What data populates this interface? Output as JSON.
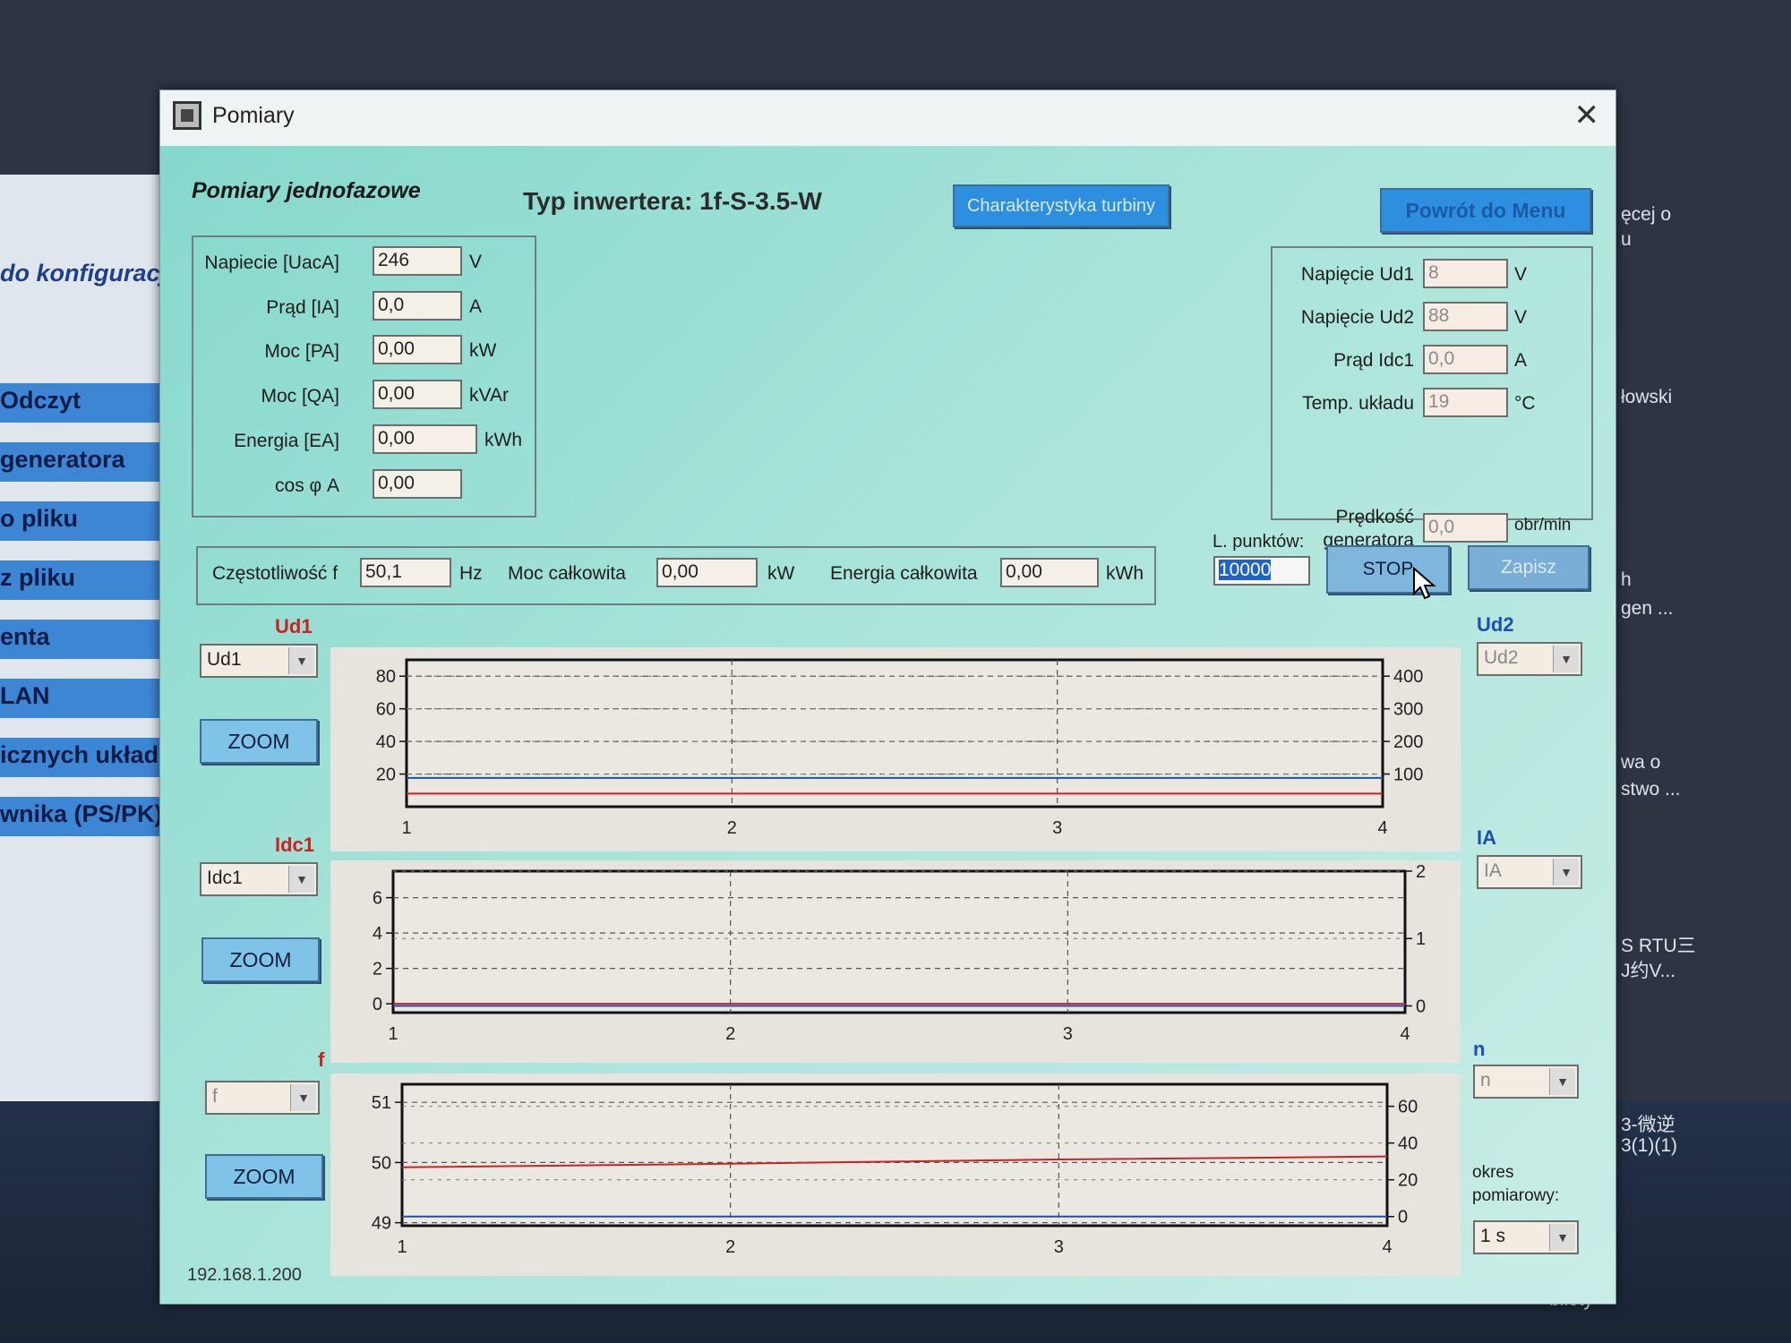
{
  "background_app": {
    "title": "do konfiguracji",
    "menu_items": [
      "Odczyt",
      "generatora",
      "o pliku",
      "z pliku",
      "enta",
      "LAN",
      "icznych układu",
      "wnika (PS/PK)"
    ],
    "right_texts": [
      "ęcej o",
      "u",
      "łowski",
      "h",
      "gen ...",
      "wa o",
      "stwo ...",
      "S RTU三",
      "J约V...",
      "3-微逆",
      "3(1)(1)",
      "bilety"
    ]
  },
  "window": {
    "title": "Pomiary",
    "close_icon": "close-icon"
  },
  "header": {
    "section_title": "Pomiary jednofazowe",
    "inverter_type": "Typ inwertera: 1f-S-3.5-W",
    "turbine_button": "Charakterystyka turbiny",
    "menu_button": "Powrót do Menu"
  },
  "ac_measurements": [
    {
      "label": "Napiecie [UacA]",
      "value": "246",
      "unit": "V"
    },
    {
      "label": "Prąd [IA]",
      "value": "0,0",
      "unit": "A"
    },
    {
      "label": "Moc [PA]",
      "value": "0,00",
      "unit": "kW"
    },
    {
      "label": "Moc [QA]",
      "value": "0,00",
      "unit": "kVAr"
    },
    {
      "label": "Energia [EA]",
      "value": "0,00",
      "unit": "kWh"
    },
    {
      "label": "cos φ A",
      "value": "0,00",
      "unit": ""
    }
  ],
  "dc_measurements": [
    {
      "label": "Napięcie Ud1",
      "value": "8",
      "unit": "V"
    },
    {
      "label": "Napięcie Ud2",
      "value": "88",
      "unit": "V"
    },
    {
      "label": "Prąd Idc1",
      "value": "0,0",
      "unit": "A"
    },
    {
      "label": "Temp. układu",
      "value": "19",
      "unit": "°C"
    }
  ],
  "generator_speed": {
    "label_line1": "Prędkość",
    "label_line2": "generatora",
    "value": "0,0",
    "unit": "obr/min"
  },
  "totals": {
    "freq_label": "Częstotliwość f",
    "freq_value": "50,1",
    "freq_unit": "Hz",
    "power_label": "Moc całkowita",
    "power_value": "0,00",
    "power_unit": "kW",
    "energy_label": "Energia całkowita",
    "energy_value": "0,00",
    "energy_unit": "kWh"
  },
  "controls": {
    "points_label": "L. punktów:",
    "points_value": "10000",
    "stop_button": "STOP",
    "save_button": "Zapisz",
    "period_label_1": "okres",
    "period_label_2": "pomiarowy:",
    "period_value": "1 s"
  },
  "status": {
    "ip": "192.168.1.200"
  },
  "charts": [
    {
      "left_title": "Ud1",
      "left_select": "Ud1",
      "right_title": "Ud2",
      "right_select": "Ud2",
      "zoom": "ZOOM",
      "left_color": "#cc2222",
      "right_color": "#1e4fb8"
    },
    {
      "left_title": "Idc1",
      "left_select": "Idc1",
      "right_title": "IA",
      "right_select": "IA",
      "zoom": "ZOOM",
      "left_color": "#cc2222",
      "right_color": "#1e4fb8"
    },
    {
      "left_title": "f",
      "left_select": "f",
      "right_title": "n",
      "right_select": "n",
      "zoom": "ZOOM",
      "left_color": "#cc2222",
      "right_color": "#1e4fb8"
    }
  ],
  "chart_data": [
    {
      "type": "line",
      "x_ticks": [
        "1",
        "2",
        "3",
        "4"
      ],
      "xlim": [
        1,
        4
      ],
      "y_left_ticks": [
        "20",
        "40",
        "60",
        "80"
      ],
      "ylim_left": [
        0,
        90
      ],
      "y_right_ticks": [
        "100",
        "200",
        "300",
        "400"
      ],
      "ylim_right": [
        0,
        450
      ],
      "series": [
        {
          "axis": "left",
          "color": "#cc2222",
          "x": [
            1,
            4
          ],
          "y": [
            8,
            8
          ]
        },
        {
          "axis": "right",
          "color": "#1e4fb8",
          "x": [
            1,
            4
          ],
          "y": [
            88,
            88
          ]
        }
      ],
      "grid": true
    },
    {
      "type": "line",
      "x_ticks": [
        "1",
        "2",
        "3",
        "4"
      ],
      "xlim": [
        1,
        4
      ],
      "y_left_ticks": [
        "0",
        "2",
        "4",
        "6"
      ],
      "ylim_left": [
        -0.5,
        7.5
      ],
      "y_right_ticks": [
        "0",
        "1",
        "2"
      ],
      "ylim_right": [
        -0.1,
        2.0
      ],
      "series": [
        {
          "axis": "left",
          "color": "#cc2222",
          "x": [
            1,
            4
          ],
          "y": [
            0,
            0
          ]
        },
        {
          "axis": "right",
          "color": "#1e4fb8",
          "x": [
            1,
            4
          ],
          "y": [
            0,
            0
          ]
        }
      ],
      "grid": true
    },
    {
      "type": "line",
      "x_ticks": [
        "1",
        "2",
        "3",
        "4"
      ],
      "xlim": [
        1,
        4
      ],
      "y_left_ticks": [
        "49",
        "50",
        "51"
      ],
      "ylim_left": [
        48.95,
        51.3
      ],
      "y_right_ticks": [
        "0",
        "20",
        "40",
        "60"
      ],
      "ylim_right": [
        -5,
        72
      ],
      "series": [
        {
          "axis": "left",
          "color": "#cc2222",
          "x": [
            1,
            2,
            3,
            4
          ],
          "y": [
            49.92,
            49.98,
            50.05,
            50.1
          ]
        },
        {
          "axis": "right",
          "color": "#1e4fb8",
          "x": [
            1,
            4
          ],
          "y": [
            0,
            0
          ]
        }
      ],
      "grid": true
    }
  ]
}
